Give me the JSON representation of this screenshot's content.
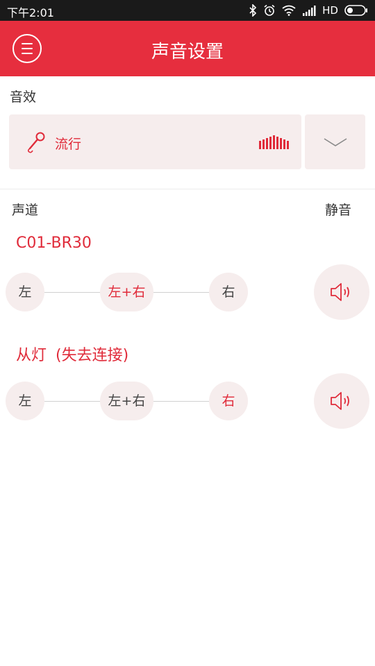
{
  "status_bar": {
    "time": "下午2:01",
    "network": "HD",
    "icons": [
      "bluetooth-icon",
      "alarm-icon",
      "wifi-icon",
      "signal-icon",
      "battery-icon"
    ]
  },
  "app_bar": {
    "title": "声音设置",
    "menu_icon": "menu-icon"
  },
  "sound_effect": {
    "label": "音效",
    "selected": "流行",
    "icon": "microphone-icon",
    "visual_icon": "equalizer-icon",
    "dropdown_icon": "chevron-down-icon"
  },
  "channel_header": {
    "channel_label": "声道",
    "mute_label": "静音"
  },
  "devices": [
    {
      "name": "C01-BR30",
      "status": "",
      "options": [
        "左",
        "左+右",
        "右"
      ],
      "selected": "左+右",
      "mute_icon": "speaker-icon"
    },
    {
      "name": "从灯",
      "status": "(失去连接)",
      "options": [
        "左",
        "左+右",
        "右"
      ],
      "selected": "右",
      "mute_icon": "speaker-icon"
    }
  ],
  "colors": {
    "accent": "#e62e3e",
    "accent_text": "#e02b3a",
    "pill_background": "#f6eded",
    "status_bar": "#1a1a1a"
  }
}
